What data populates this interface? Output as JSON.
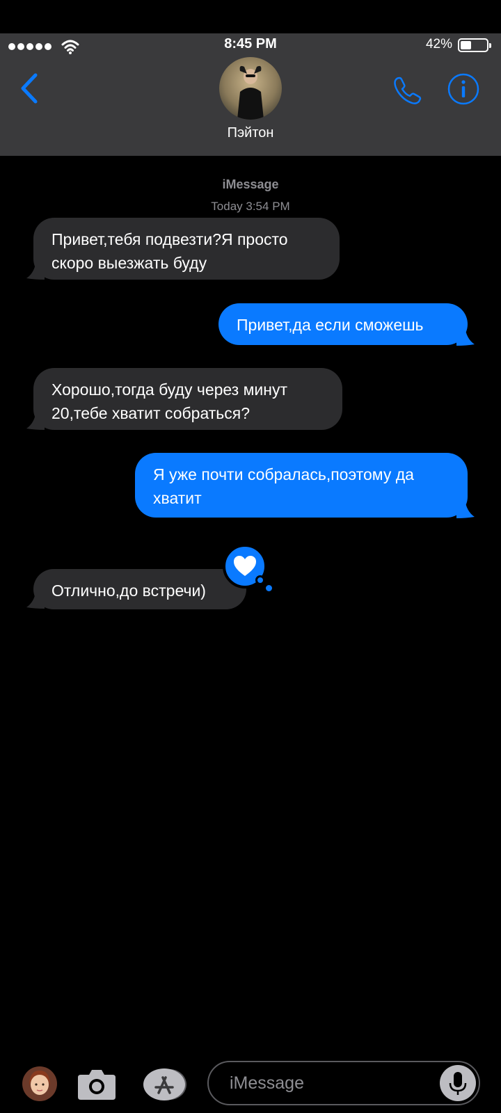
{
  "status": {
    "time": "8:45 PM",
    "battery_percent": "42%",
    "battery_level": 0.42
  },
  "contact": {
    "name": "Пэйтон"
  },
  "thread": {
    "service_label": "iMessage",
    "timestamp": "Today 3:54 PM"
  },
  "messages": [
    {
      "direction": "incoming",
      "lines": [
        "Привет,тебя подвезти?Я просто",
        "скоро выезжать буду"
      ]
    },
    {
      "direction": "outgoing",
      "lines": [
        "Привет,да если сможешь"
      ]
    },
    {
      "direction": "incoming",
      "lines": [
        "Хорошо,тогда буду через минут",
        "20,тебе хватит собраться?"
      ]
    },
    {
      "direction": "outgoing",
      "lines": [
        "Я уже почти собралась,поэтому да",
        "хватит"
      ]
    },
    {
      "direction": "incoming",
      "lines": [
        "Отлично,до встречи)"
      ],
      "tapback": "heart-icon"
    }
  ],
  "composer": {
    "placeholder": "iMessage"
  },
  "colors": {
    "header_bg": "#3a3a3c",
    "accent": "#0a7aff",
    "incoming_bubble": "#2c2c2e",
    "background": "#000000"
  }
}
